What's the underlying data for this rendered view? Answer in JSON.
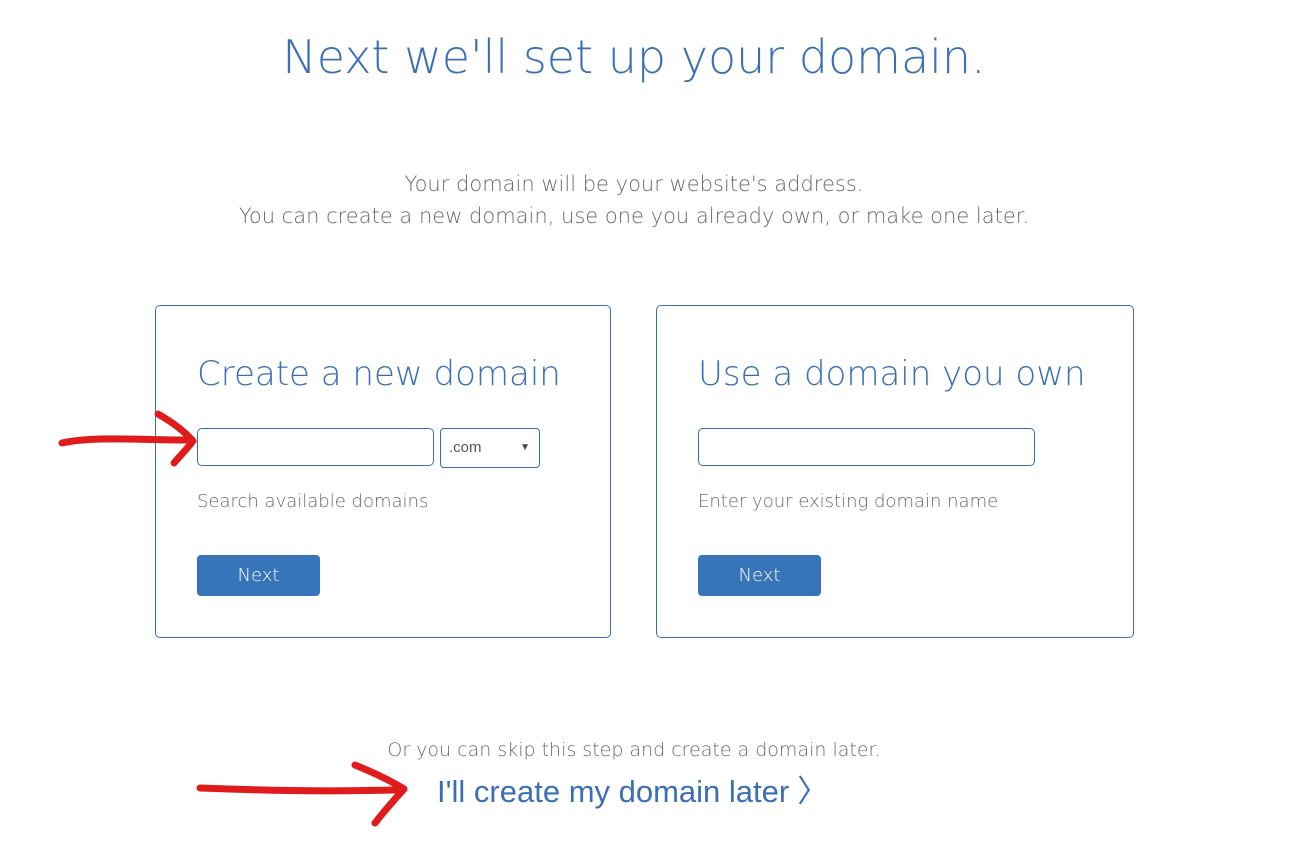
{
  "header": {
    "title": "Next we'll set up your domain."
  },
  "intro": {
    "line1": "Your domain will be your website's address.",
    "line2": "You can create a new domain, use one you already own, or make one later."
  },
  "new_domain": {
    "title": "Create a new domain",
    "input_value": "",
    "tld_selected": ".com",
    "hint": "Search available domains",
    "next_label": "Next"
  },
  "own_domain": {
    "title": "Use a domain you own",
    "input_value": "",
    "hint": "Enter your existing domain name",
    "next_label": "Next"
  },
  "skip": {
    "text": "Or you can skip this step and create a domain later.",
    "link_label": "I'll create my domain later",
    "link_chevron": "〉"
  },
  "colors": {
    "accent": "#3a6fb5",
    "button": "#3874b9",
    "muted_text": "#6a6a6a",
    "annotation": "#e01b1b"
  },
  "icons": {
    "select_caret": "▼"
  }
}
